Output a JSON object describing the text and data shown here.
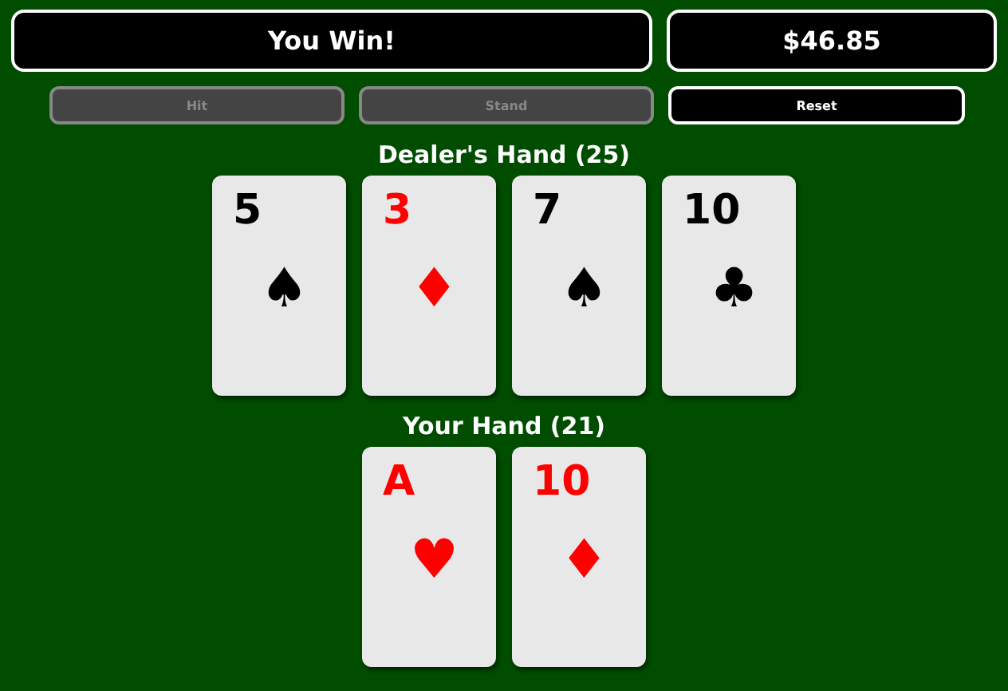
{
  "status": {
    "message": "You Win!",
    "balance": "$46.85"
  },
  "buttons": [
    {
      "label": "Hit",
      "disabled": true
    },
    {
      "label": "Stand",
      "disabled": true
    },
    {
      "label": "Reset",
      "disabled": false
    }
  ],
  "hands": [
    {
      "title": "Dealer's Hand (25)",
      "cards": [
        {
          "rank": "5",
          "suit": "♠",
          "color": "#000000"
        },
        {
          "rank": "3",
          "suit": "♦",
          "color": "#ff0000"
        },
        {
          "rank": "7",
          "suit": "♠",
          "color": "#000000"
        },
        {
          "rank": "10",
          "suit": "♣",
          "color": "#000000"
        }
      ]
    },
    {
      "title": "Your Hand (21)",
      "cards": [
        {
          "rank": "A",
          "suit": "♥",
          "color": "#ff0000"
        },
        {
          "rank": "10",
          "suit": "♦",
          "color": "#ff0000"
        }
      ]
    }
  ]
}
